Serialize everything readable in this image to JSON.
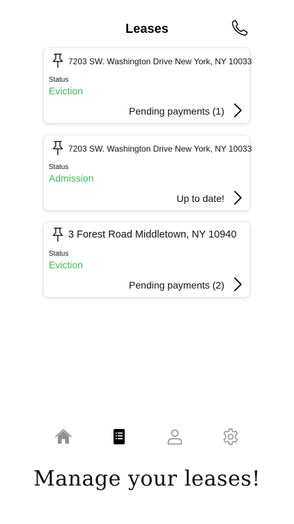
{
  "header": {
    "title": "Leases",
    "phone_icon": "phone-icon"
  },
  "leases": [
    {
      "address": "7203 SW. Washington Drive New York, NY 10033",
      "status_label": "Status",
      "status": "Eviction",
      "action": "Pending payments (1)"
    },
    {
      "address": "7203 SW. Washington Drive New York, NY 10033",
      "status_label": "Status",
      "status": "Admission",
      "action": "Up to date!"
    },
    {
      "address": "3 Forest Road Middletown, NY 10940",
      "status_label": "Status",
      "status": "Eviction",
      "action": "Pending payments (2)"
    }
  ],
  "colors": {
    "status": "#3dbb4f",
    "tab_inactive": "#8e8e93",
    "tab_active": "#000000"
  },
  "tabs": [
    {
      "icon": "home-icon",
      "active": false
    },
    {
      "icon": "leases-icon",
      "active": true
    },
    {
      "icon": "profile-icon",
      "active": false
    },
    {
      "icon": "settings-icon",
      "active": false
    }
  ],
  "tagline": "Manage your leases!"
}
